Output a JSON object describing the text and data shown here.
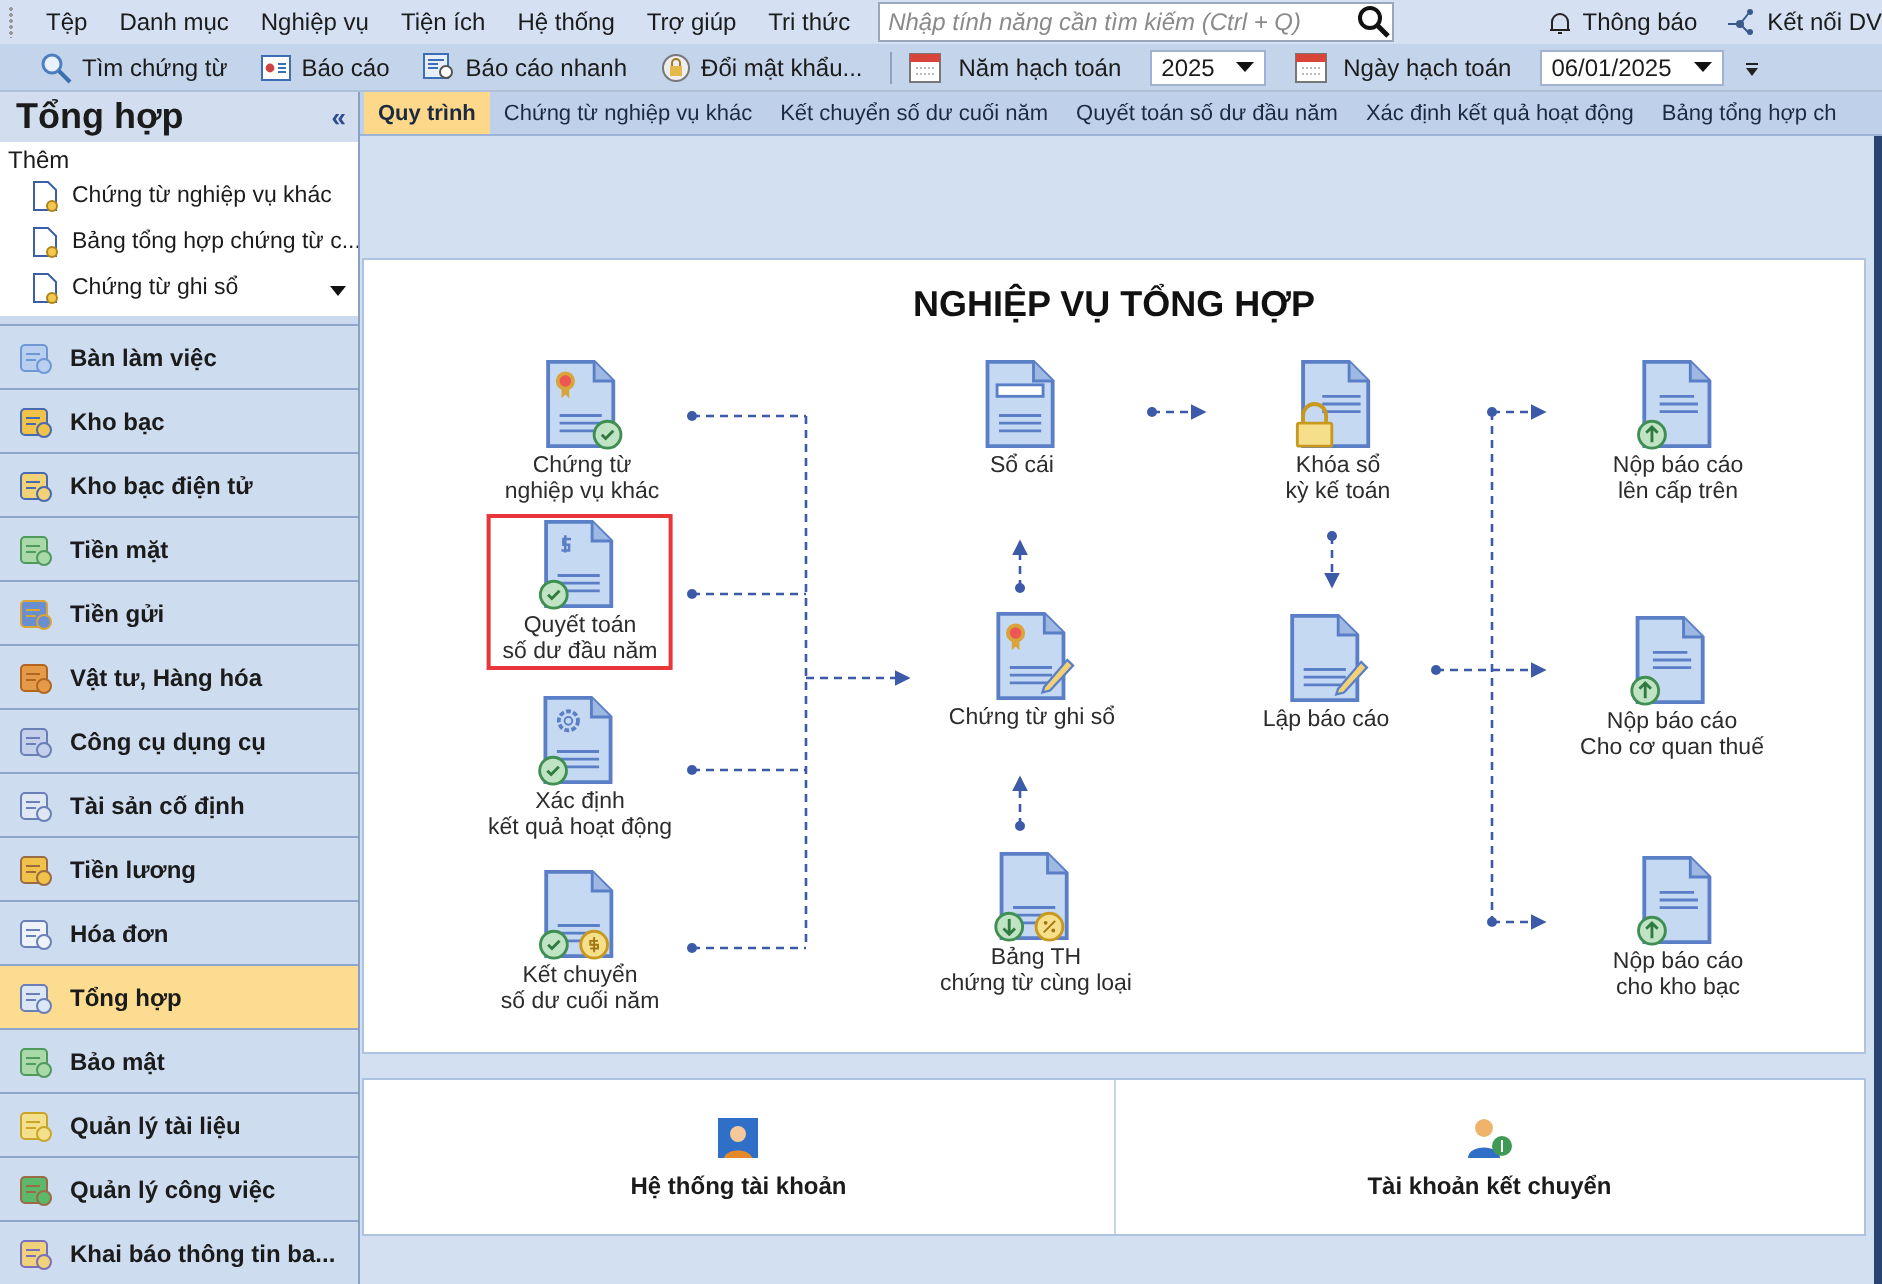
{
  "menu": [
    "Tệp",
    "Danh mục",
    "Nghiệp vụ",
    "Tiện ích",
    "Hệ thống",
    "Trợ giúp",
    "Tri thức"
  ],
  "search": {
    "placeholder": "Nhập tính năng cần tìm kiếm (Ctrl + Q)"
  },
  "header_actions": [
    "Thông báo",
    "Kết nối DV"
  ],
  "toolbar": {
    "buttons": [
      "Tìm chứng từ",
      "Báo cáo",
      "Báo cáo nhanh",
      "Đổi mật khẩu..."
    ],
    "year": {
      "label": "Năm hạch toán",
      "value": "2025"
    },
    "date": {
      "label": "Ngày hạch toán",
      "value": "06/01/2025"
    }
  },
  "sidebar": {
    "title": "Tổng hợp",
    "collapse": "«",
    "section": "Thêm",
    "links": [
      "Chứng từ nghiệp vụ khác",
      "Bảng tổng hợp chứng từ c...",
      "Chứng từ ghi sổ"
    ],
    "items": [
      {
        "label": "Bàn làm việc",
        "selected": false
      },
      {
        "label": "Kho bạc",
        "selected": false
      },
      {
        "label": "Kho bạc điện tử",
        "selected": false
      },
      {
        "label": "Tiền mặt",
        "selected": false
      },
      {
        "label": "Tiền gửi",
        "selected": false
      },
      {
        "label": "Vật tư, Hàng hóa",
        "selected": false
      },
      {
        "label": "Công cụ dụng cụ",
        "selected": false
      },
      {
        "label": "Tài sản cố định",
        "selected": false
      },
      {
        "label": "Tiền lương",
        "selected": false
      },
      {
        "label": "Hóa đơn",
        "selected": false
      },
      {
        "label": "Tổng hợp",
        "selected": true
      },
      {
        "label": "Bảo mật",
        "selected": false
      },
      {
        "label": "Quản lý tài liệu",
        "selected": false
      },
      {
        "label": "Quản lý công việc",
        "selected": false
      },
      {
        "label": "Khai báo thông tin ba...",
        "selected": false
      }
    ]
  },
  "tabs": [
    {
      "label": "Quy trình",
      "selected": true
    },
    {
      "label": "Chứng từ nghiệp vụ khác",
      "selected": false
    },
    {
      "label": "Kết chuyển số dư cuối năm",
      "selected": false
    },
    {
      "label": "Quyết toán số dư đầu năm",
      "selected": false
    },
    {
      "label": "Xác định kết quả hoạt động",
      "selected": false
    },
    {
      "label": "Bảng tổng hợp ch",
      "selected": false
    }
  ],
  "diagram": {
    "title": "NGHIỆP VỤ TỔNG HỢP",
    "nodes": [
      {
        "label": "Chứng từ\nnghiệp vụ khác",
        "highlighted": false
      },
      {
        "label": "Quyết toán\nsố dư đầu năm",
        "highlighted": true
      },
      {
        "label": "Xác định\nkết quả hoạt động",
        "highlighted": false
      },
      {
        "label": "Kết chuyển\nsố dư cuối năm",
        "highlighted": false
      },
      {
        "label": "Sổ cái",
        "highlighted": false
      },
      {
        "label": "Chứng từ ghi sổ",
        "highlighted": false
      },
      {
        "label": "Bảng TH\nchứng từ cùng loại",
        "highlighted": false
      },
      {
        "label": "Khóa sổ\nkỳ kế toán",
        "highlighted": false
      },
      {
        "label": "Lập báo cáo",
        "highlighted": false
      },
      {
        "label": "Nộp báo cáo\nlên cấp trên",
        "highlighted": false
      },
      {
        "label": "Nộp báo cáo\nCho cơ quan thuế",
        "highlighted": false
      },
      {
        "label": "Nộp báo cáo\ncho kho bạc",
        "highlighted": false
      }
    ]
  },
  "shortcuts": [
    "Hệ thống tài khoản",
    "Tài khoản kết chuyển"
  ]
}
